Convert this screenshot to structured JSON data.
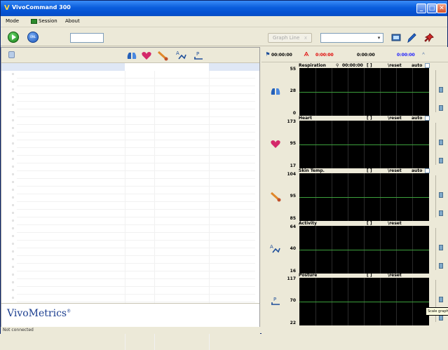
{
  "window": {
    "title": "VivoCommand 300"
  },
  "menu": {
    "items": [
      "Mode",
      "Session",
      "About"
    ]
  },
  "toolbar": {
    "onl_label": "ONL",
    "grayed_button_label": "Graph Line",
    "grayed_button_x": "x"
  },
  "left_panel": {
    "logo": "VivoMetrics",
    "logo_mark": "®"
  },
  "status": {
    "text": "Not connected"
  },
  "timebar": {
    "elapsed": "00:00:00",
    "red_time": "0:00:00",
    "center_time": "0:00:00",
    "blue_time": "0:00:00"
  },
  "charts": [
    {
      "title": "Respiration",
      "extra_time": "00:00:00",
      "extra_brackets": "[ ]",
      "reset": "\\reset",
      "auto": "auto",
      "has_auto": true,
      "ticks": [
        "55",
        "28",
        "0"
      ]
    },
    {
      "title": "Heart",
      "extra_time": "",
      "extra_brackets": "[ ]",
      "reset": "\\reset",
      "auto": "auto",
      "has_auto": true,
      "ticks": [
        "173",
        "95",
        "17"
      ]
    },
    {
      "title": "Skin Temp.",
      "extra_time": "",
      "extra_brackets": "[ ]",
      "reset": "\\reset",
      "auto": "auto",
      "has_auto": true,
      "ticks": [
        "104",
        "95",
        "85"
      ]
    },
    {
      "title": "Activity",
      "extra_time": "",
      "extra_brackets": "[ ]",
      "reset": "\\reset",
      "auto": "",
      "has_auto": false,
      "ticks": [
        "64",
        "40",
        "16"
      ]
    },
    {
      "title": "Posture",
      "extra_time": "",
      "extra_brackets": "[ ]",
      "reset": "\\reset",
      "auto": "",
      "has_auto": false,
      "ticks": [
        "117",
        "70",
        "22"
      ]
    }
  ],
  "tooltip": {
    "text": "Scale graph"
  },
  "colors": {
    "titlebar": "#0a5ddc",
    "plot_bg": "#000000",
    "red_time": "#e00000",
    "blue_time": "#1a1aff"
  }
}
